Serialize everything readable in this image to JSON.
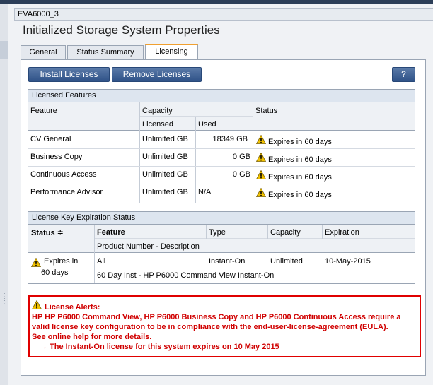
{
  "window": {
    "title": "EVA6000_3",
    "page_title": "Initialized Storage System Properties"
  },
  "tabs": [
    {
      "label": "General",
      "active": false
    },
    {
      "label": "Status Summary",
      "active": false
    },
    {
      "label": "Licensing",
      "active": true
    }
  ],
  "toolbar": {
    "install": "Install Licenses",
    "remove": "Remove Licenses",
    "help": "?"
  },
  "features": {
    "title": "Licensed Features",
    "headers": {
      "feature": "Feature",
      "capacity": "Capacity",
      "licensed": "Licensed",
      "used": "Used",
      "status": "Status"
    },
    "rows": [
      {
        "feature": "CV General",
        "licensed": "Unlimited GB",
        "used": "18349 GB",
        "status": "Expires in 60 days"
      },
      {
        "feature": "Business Copy",
        "licensed": "Unlimited GB",
        "used": "0 GB",
        "status": "Expires in 60 days"
      },
      {
        "feature": "Continuous Access",
        "licensed": "Unlimited GB",
        "used": "0 GB",
        "status": "Expires in 60 days"
      },
      {
        "feature": "Performance Advisor",
        "licensed": "Unlimited GB",
        "used": "N/A",
        "status": "Expires in 60 days"
      }
    ]
  },
  "expiration": {
    "title": "License Key Expiration Status",
    "headers": {
      "status": "Status",
      "feature": "Feature",
      "type": "Type",
      "capacity": "Capacity",
      "expiration": "Expiration",
      "product": "Product Number - Description"
    },
    "row": {
      "status_line1": "Expires in",
      "status_line2": "60 days",
      "feature": "All",
      "type": "Instant-On",
      "capacity": "Unlimited",
      "expiration": "10-May-2015",
      "description": "60 Day Inst - HP P6000 Command View Instant-On"
    }
  },
  "alert": {
    "title": "License Alerts:",
    "line1": "HP HP P6000 Command View, HP P6000 Business Copy and HP P6000 Continuous Access require a",
    "line2": "valid license key configuration to be in compliance with the end-user-license-agreement (EULA).",
    "line3": "See online help for more details.",
    "line4": "→ The Instant-On license for this system expires on 10 May 2015"
  },
  "colors": {
    "button": "#2f5288",
    "alert": "#e00000",
    "tab_active": "#f0a030",
    "warning": "#f2c200"
  },
  "icons": {
    "warning": "warning-icon",
    "sort": "sort-icon",
    "grip": "grip-icon"
  }
}
